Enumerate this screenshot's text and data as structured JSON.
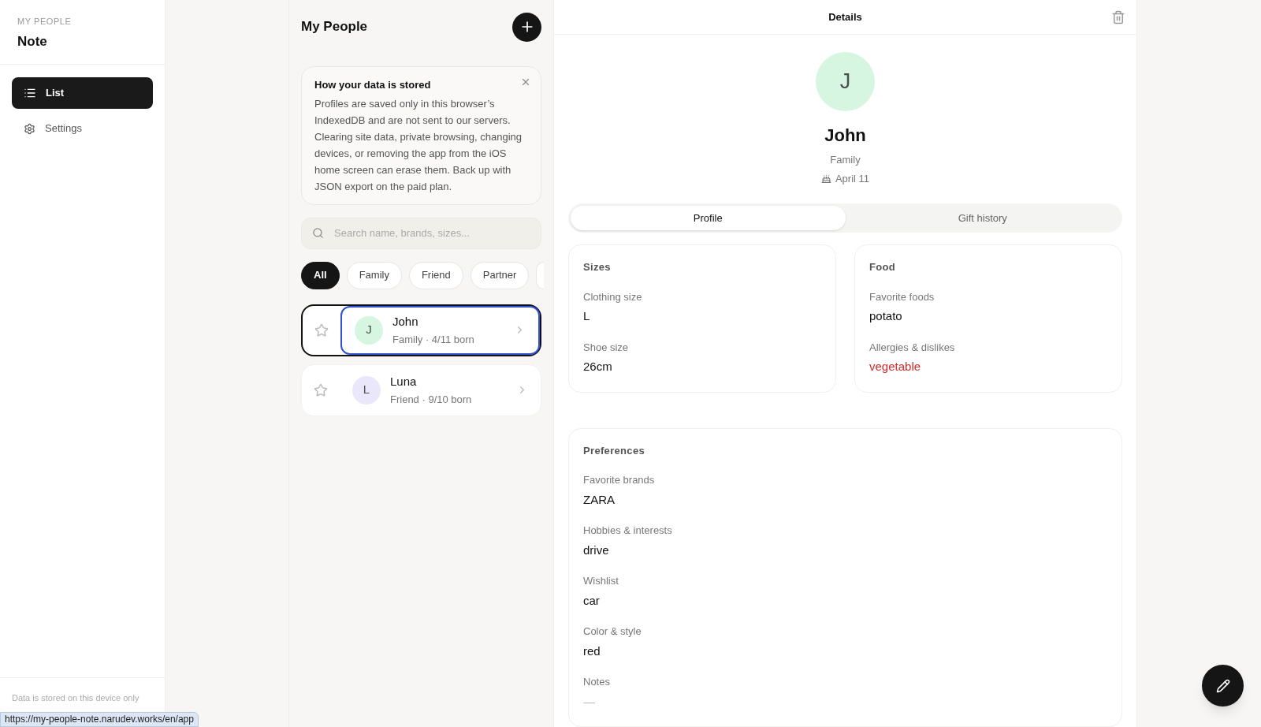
{
  "sidebar": {
    "eyebrow": "MY PEOPLE",
    "title": "Note",
    "items": [
      {
        "kind": "list",
        "label": "List",
        "selected": true
      },
      {
        "kind": "settings",
        "label": "Settings",
        "selected": false
      }
    ],
    "footer": "Data is stored on this device only"
  },
  "status_url": "https://my-people-note.narudev.works/en/app",
  "list": {
    "title": "My People",
    "notice": {
      "title": "How your data is stored",
      "body": "Profiles are saved only in this browser’s IndexedDB and are not sent to our servers. Clearing site data, private browsing, changing devices, or removing the app from the iOS home screen can erase them. Back up with JSON export on the paid plan."
    },
    "search": {
      "placeholder": "Search name, brands, sizes..."
    },
    "filters": [
      {
        "label": "All",
        "selected": true
      },
      {
        "label": "Family",
        "selected": false
      },
      {
        "label": "Friend",
        "selected": false
      },
      {
        "label": "Partner",
        "selected": false
      },
      {
        "selected": false
      }
    ],
    "people": [
      {
        "initial": "J",
        "name": "John",
        "meta": "Family · 4/11 born",
        "color": "#d6f6e2",
        "starred": false,
        "selected": true
      },
      {
        "initial": "L",
        "name": "Luna",
        "meta": "Friend · 9/10 born",
        "color": "#ebe7fb",
        "starred": false,
        "selected": false
      }
    ]
  },
  "details": {
    "title": "Details",
    "initial": "J",
    "color": "#d6f6e2",
    "name": "John",
    "group": "Family",
    "birthday": "April 11",
    "tabs": [
      {
        "label": "Profile",
        "selected": true
      },
      {
        "label": "Gift history",
        "selected": false
      }
    ],
    "sections": [
      {
        "title": "Sizes",
        "fields": [
          {
            "label": "Clothing size",
            "value": "L",
            "alert": false,
            "muted": false
          },
          {
            "label": "Shoe size",
            "value": "26cm",
            "alert": false,
            "muted": false
          }
        ]
      },
      {
        "title": "Food",
        "fields": [
          {
            "label": "Favorite foods",
            "value": "potato",
            "alert": false,
            "muted": false
          },
          {
            "label": "Allergies & dislikes",
            "value": "vegetable",
            "alert": true,
            "muted": false
          }
        ]
      },
      {
        "title": "Preferences",
        "fields": [
          {
            "label": "Favorite brands",
            "value": "ZARA",
            "alert": false,
            "muted": false
          },
          {
            "label": "Hobbies & interests",
            "value": "drive",
            "alert": false,
            "muted": false
          },
          {
            "label": "Wishlist",
            "value": "car",
            "alert": false,
            "muted": false
          },
          {
            "label": "Color & style",
            "value": "red",
            "alert": false,
            "muted": false
          },
          {
            "label": "Notes",
            "value": "—",
            "alert": false,
            "muted": true
          }
        ]
      }
    ]
  }
}
